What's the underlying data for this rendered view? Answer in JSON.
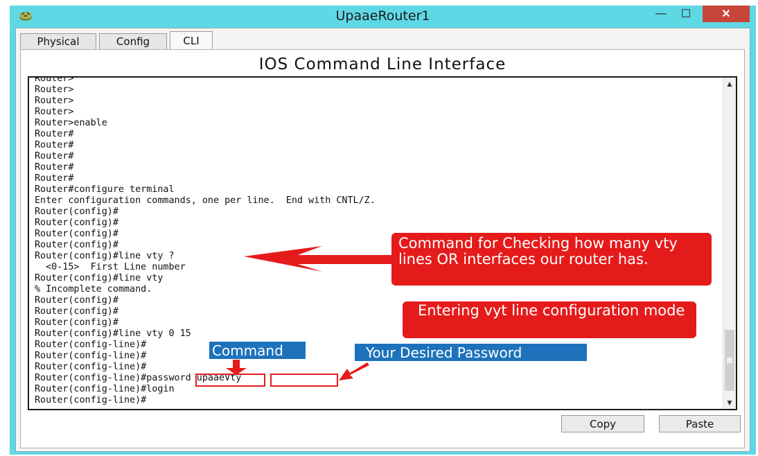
{
  "window": {
    "title": "UpaaeRouter1",
    "controls": {
      "minimize": "—",
      "maximize": "☐",
      "close": "✕"
    }
  },
  "tabs": [
    {
      "label": "Physical",
      "active": false
    },
    {
      "label": "Config",
      "active": false
    },
    {
      "label": "CLI",
      "active": true
    }
  ],
  "panel": {
    "title": "IOS Command Line Interface"
  },
  "terminal": {
    "lines": [
      "Router>",
      "Router>",
      "Router>",
      "Router>",
      "Router>enable",
      "Router#",
      "Router#",
      "Router#",
      "Router#",
      "Router#",
      "Router#configure terminal",
      "Enter configuration commands, one per line.  End with CNTL/Z.",
      "Router(config)#",
      "Router(config)#",
      "Router(config)#",
      "Router(config)#",
      "Router(config)#line vty ?",
      "  <0-15>  First Line number",
      "Router(config)#line vty",
      "% Incomplete command.",
      "Router(config)#",
      "Router(config)#",
      "Router(config)#",
      "Router(config)#line vty 0 15",
      "Router(config-line)#",
      "Router(config-line)#",
      "Router(config-line)#",
      "Router(config-line)#password upaaeVty",
      "Router(config-line)#login",
      "Router(config-line)#"
    ]
  },
  "buttons": {
    "copy": "Copy",
    "paste": "Paste"
  },
  "annotations": {
    "check_lines": "Command for Checking how many vty lines OR interfaces our router has.",
    "line_config": "Entering vyt line configuration mode",
    "command_label": "Command",
    "password_label": "Your Desired Password",
    "callout_color": "#e51b1b",
    "label_color": "#1d72bb"
  }
}
